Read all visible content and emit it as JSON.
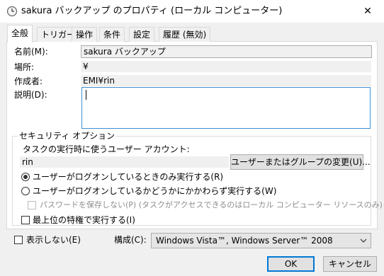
{
  "window": {
    "title": "sakura バックアップ のプロパティ (ローカル コンピューター)",
    "close_glyph": "✕"
  },
  "tabs": [
    {
      "label": "全般",
      "active": true
    },
    {
      "label": "トリガー",
      "active": false
    },
    {
      "label": "操作",
      "active": false
    },
    {
      "label": "条件",
      "active": false
    },
    {
      "label": "設定",
      "active": false
    },
    {
      "label": "履歴 (無効)",
      "active": false
    }
  ],
  "general": {
    "name_label": "名前(M):",
    "name_value": "sakura バックアップ",
    "location_label": "場所:",
    "location_value": "¥",
    "author_label": "作成者:",
    "author_value": "EMI¥rin",
    "description_label": "説明(D):",
    "description_value": ""
  },
  "security": {
    "group_title": "セキュリティ オプション",
    "account_label": "タスクの実行時に使うユーザー アカウント:",
    "account_value": "rin",
    "change_button": "ユーザーまたはグループの変更(U)...",
    "radio_logged_on": "ユーザーがログオンしているときのみ実行する(R)",
    "radio_any": "ユーザーがログオンしているかどうかにかかわらず実行する(W)",
    "no_store_password": "パスワードを保存しない(P) (タスクがアクセスできるのはローカル コンピューター リソースのみ)",
    "highest_privileges": "最上位の特権で実行する(I)"
  },
  "bottom": {
    "hidden_label": "表示しない(E)",
    "configure_label": "構成(C):",
    "configure_value": "Windows Vista™, Windows Server™ 2008"
  },
  "buttons": {
    "ok": "OK",
    "cancel": "キャンセル"
  },
  "colors": {
    "accent": "#0078d7",
    "window_bg": "#f0f0f0",
    "panel_bg": "#ffffff"
  }
}
